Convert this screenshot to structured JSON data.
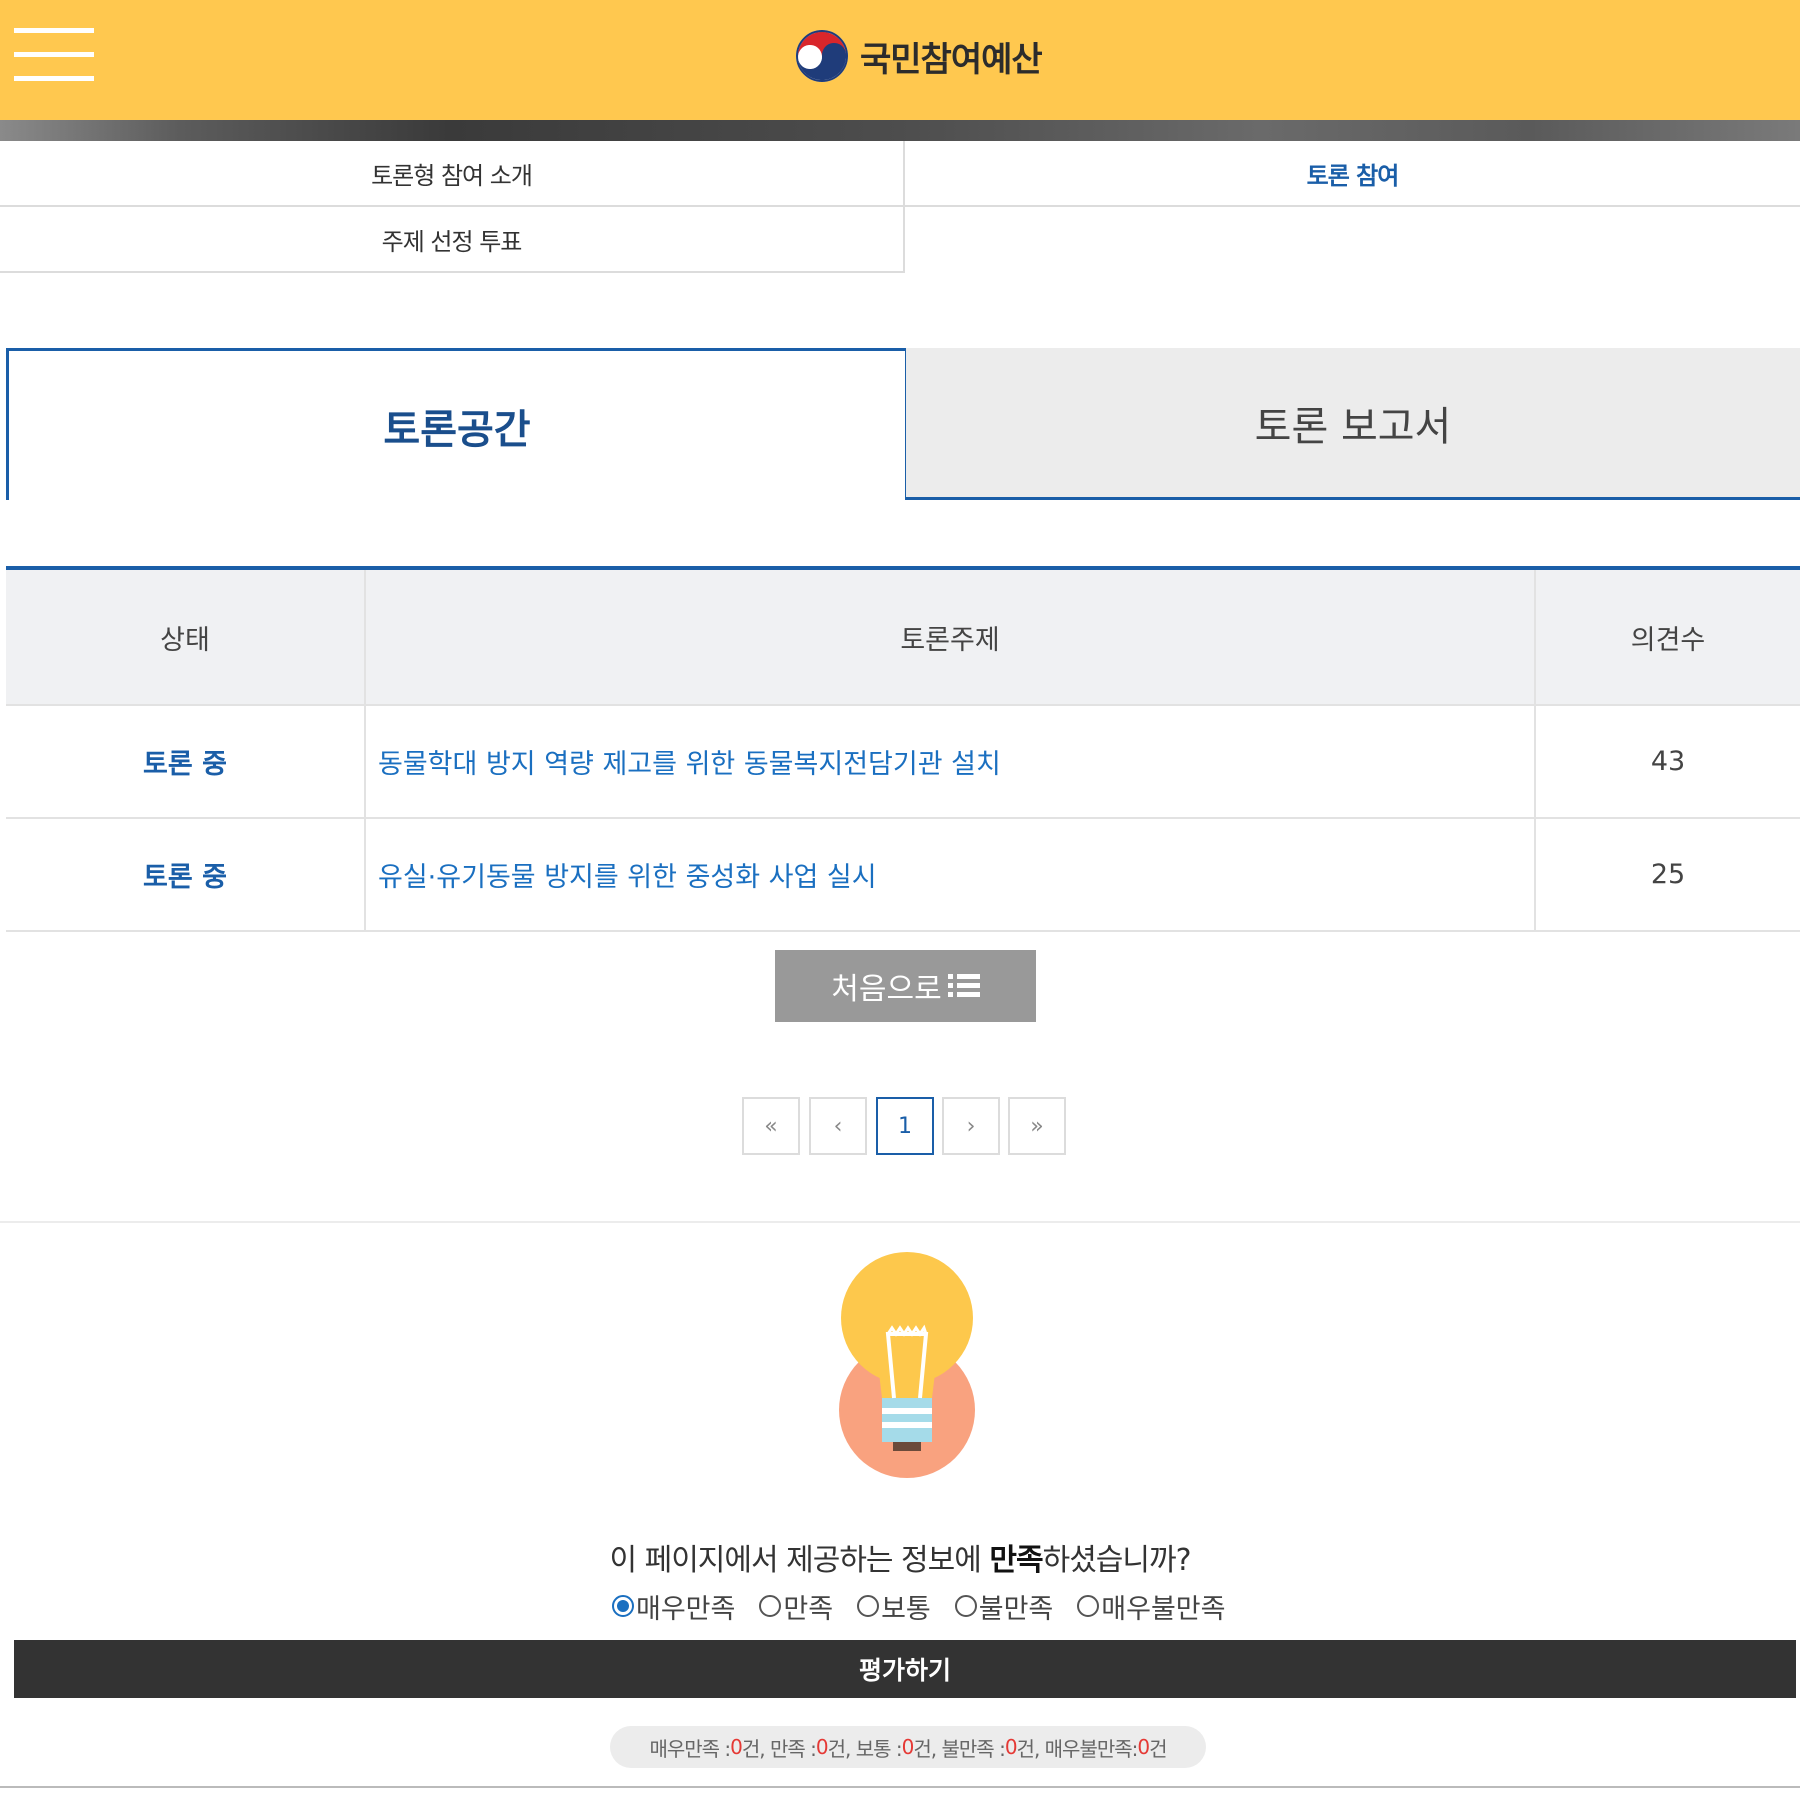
{
  "header": {
    "logo_text": "국민참여예산"
  },
  "subnav": {
    "items": [
      {
        "label": "토론형 참여 소개"
      },
      {
        "label": "토론 참여"
      },
      {
        "label": "주제 선정 투표"
      }
    ],
    "active_index": 1
  },
  "tabs": [
    {
      "label": "토론공간",
      "active": true
    },
    {
      "label": "토론 보고서",
      "active": false
    }
  ],
  "table": {
    "headers": [
      "상태",
      "토론주제",
      "의견수"
    ],
    "rows": [
      {
        "status": "토론 중",
        "topic": "동물학대 방지 역량 제고를 위한 동물복지전담기관 설치",
        "count": "43"
      },
      {
        "status": "토론 중",
        "topic": "유실·유기동물 방지를 위한 중성화 사업 실시",
        "count": "25"
      }
    ]
  },
  "first_button": {
    "label": "처음으로",
    "icon": "list-icon"
  },
  "pagination": {
    "first": "«",
    "prev": "‹",
    "current": "1",
    "next": "›",
    "last": "»"
  },
  "survey": {
    "question_before": "이 페이지에서 제공하는 정보에 ",
    "question_bold": "만족",
    "question_after": "하셨습니까?",
    "options": [
      "매우만족",
      "만족",
      "보통",
      "불만족",
      "매우불만족"
    ],
    "selected": "매우만족",
    "submit_label": "평가하기",
    "results": {
      "very_satisfied_label": "매우만족 : ",
      "very_satisfied": "0",
      "satisfied_label": "건, 만족 : ",
      "satisfied": "0",
      "normal_label": "건, 보통 : ",
      "normal": "0",
      "dissatisfied_label": "건, 불만족 : ",
      "dissatisfied": "0",
      "very_dissatisfied_label": "건, 매우불만족: ",
      "very_dissatisfied": "0",
      "unit": "건"
    }
  },
  "colors": {
    "header_bg": "#ffc84f",
    "accent": "#1a5ea8",
    "link": "#1a6fc0",
    "button_gray": "#999999",
    "submit_bg": "#333333",
    "count_red": "#e53935"
  }
}
